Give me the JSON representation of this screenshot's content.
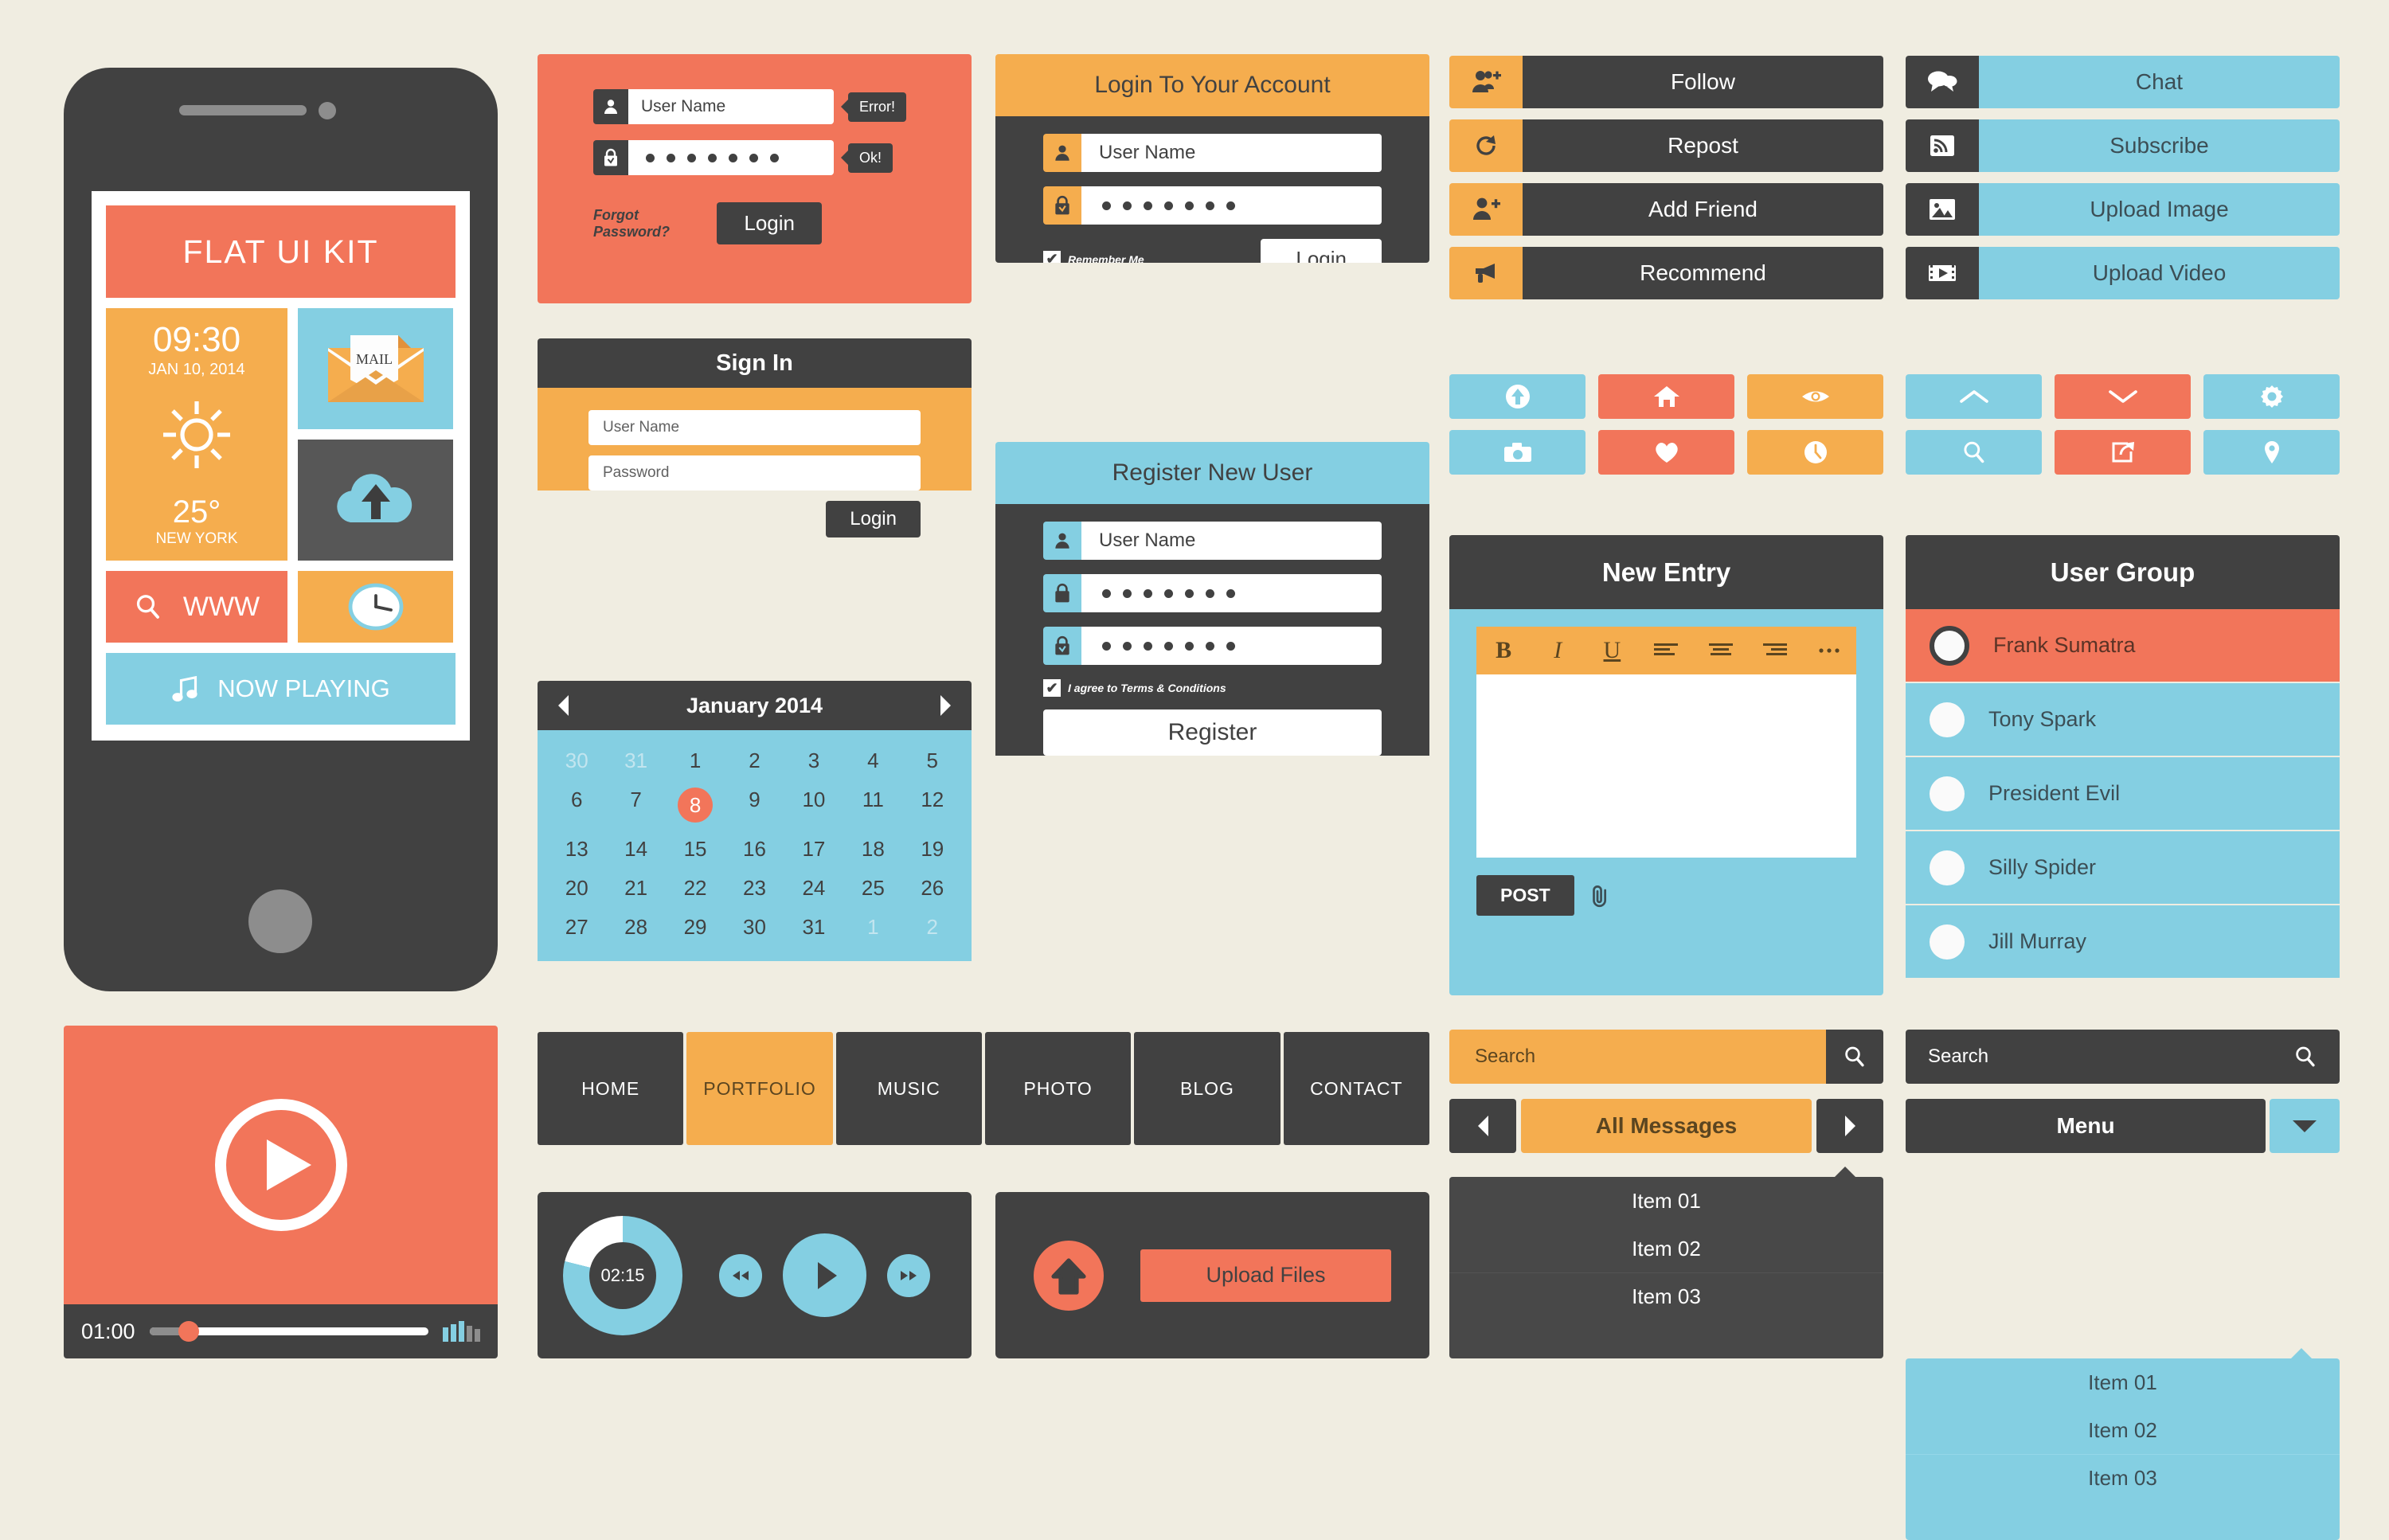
{
  "colors": {
    "background": "#f0ede1",
    "dark": "#414141",
    "orange": "#f2755a",
    "yellow": "#f5ad4e",
    "blue": "#84cfe2",
    "white": "#ffffff"
  },
  "phone": {
    "title": "FLAT UI KIT",
    "weather": {
      "time": "09:30",
      "date": "JAN 10, 2014",
      "temperature": "25°",
      "city": "NEW YORK",
      "icon": "sun-icon"
    },
    "mail_tile": {
      "label": "MAIL",
      "icon": "envelope-icon"
    },
    "cloud_tile": {
      "icon": "cloud-upload-icon"
    },
    "www_tile": {
      "label": "WWW",
      "icon": "search-icon"
    },
    "clock_tile": {
      "icon": "clock-icon"
    },
    "now_playing_tile": {
      "label": "NOW PLAYING",
      "icon": "music-note-icon"
    }
  },
  "video_player": {
    "play_icon": "play-circle-icon",
    "current_time": "01:00",
    "progress_percent": 14,
    "volume_icon": "volume-bars-icon"
  },
  "error_login_form": {
    "username_value": "User Name",
    "username_icon": "user-icon",
    "username_status": "Error!",
    "password_value": "•••••••",
    "password_icon": "lock-check-icon",
    "password_status": "Ok!",
    "forgot_label": "Forgot Password?",
    "login_label": "Login"
  },
  "signin_form": {
    "title": "Sign In",
    "username_placeholder": "User Name",
    "password_placeholder": "Password",
    "login_label": "Login"
  },
  "calendar": {
    "title": "January 2014",
    "prev_icon": "triangle-left-icon",
    "next_icon": "triangle-right-icon",
    "selected_day": 8,
    "weeks": [
      [
        {
          "d": "30",
          "mut": true
        },
        {
          "d": "31",
          "mut": true
        },
        {
          "d": "1"
        },
        {
          "d": "2"
        },
        {
          "d": "3"
        },
        {
          "d": "4"
        },
        {
          "d": "5"
        }
      ],
      [
        {
          "d": "6"
        },
        {
          "d": "7"
        },
        {
          "d": "8",
          "sel": true
        },
        {
          "d": "9"
        },
        {
          "d": "10"
        },
        {
          "d": "11"
        },
        {
          "d": "12"
        }
      ],
      [
        {
          "d": "13"
        },
        {
          "d": "14"
        },
        {
          "d": "15"
        },
        {
          "d": "16"
        },
        {
          "d": "17"
        },
        {
          "d": "18"
        },
        {
          "d": "19"
        }
      ],
      [
        {
          "d": "20"
        },
        {
          "d": "21"
        },
        {
          "d": "22"
        },
        {
          "d": "23"
        },
        {
          "d": "24"
        },
        {
          "d": "25"
        },
        {
          "d": "26"
        }
      ],
      [
        {
          "d": "27"
        },
        {
          "d": "28"
        },
        {
          "d": "29"
        },
        {
          "d": "30"
        },
        {
          "d": "31"
        },
        {
          "d": "1",
          "mut": true
        },
        {
          "d": "2",
          "mut": true
        }
      ]
    ]
  },
  "navbar": {
    "items": [
      {
        "label": "HOME",
        "active": false
      },
      {
        "label": "PORTFOLIO",
        "active": true
      },
      {
        "label": "MUSIC",
        "active": false
      },
      {
        "label": "PHOTO",
        "active": false
      },
      {
        "label": "BLOG",
        "active": false
      },
      {
        "label": "CONTACT",
        "active": false
      }
    ]
  },
  "music_player": {
    "elapsed": "02:15",
    "progress_percent": 79,
    "rewind_icon": "rewind-icon",
    "play_icon": "play-icon",
    "forward_icon": "fast-forward-icon"
  },
  "login_account_form": {
    "title": "Login To Your Account",
    "username_value": "User Name",
    "username_icon": "user-icon",
    "password_value": "•••••••",
    "password_icon": "lock-check-icon",
    "remember_label": "Remember Me",
    "remember_checked": true,
    "login_label": "Login"
  },
  "register_form": {
    "title": "Register New User",
    "username_value": "User Name",
    "username_icon": "user-icon",
    "password_value": "•••••••",
    "password_icon": "lock-icon",
    "confirm_value": "•••••••",
    "confirm_icon": "lock-check-icon",
    "terms_label": "I agree to Terms & Conditions",
    "terms_checked": true,
    "register_label": "Register"
  },
  "upload_panel": {
    "icon": "upload-arrow-icon",
    "button_label": "Upload Files"
  },
  "social_buttons_yellow": [
    {
      "label": "Follow",
      "icon": "add-users-icon"
    },
    {
      "label": "Repost",
      "icon": "repost-icon"
    },
    {
      "label": "Add Friend",
      "icon": "add-user-icon"
    },
    {
      "label": "Recommend",
      "icon": "megaphone-icon"
    }
  ],
  "social_buttons_blue": [
    {
      "label": "Chat",
      "icon": "chat-bubbles-icon"
    },
    {
      "label": "Subscribe",
      "icon": "rss-icon"
    },
    {
      "label": "Upload Image",
      "icon": "image-icon"
    },
    {
      "label": "Upload Video",
      "icon": "video-icon"
    }
  ],
  "icon_grid_left": [
    {
      "icon": "arrow-up-circle-icon",
      "color": "#84cfe2"
    },
    {
      "icon": "home-icon",
      "color": "#f2755a"
    },
    {
      "icon": "eye-icon",
      "color": "#f5ad4e"
    },
    {
      "icon": "camera-icon",
      "color": "#84cfe2"
    },
    {
      "icon": "heart-icon",
      "color": "#f2755a"
    },
    {
      "icon": "clock-icon",
      "color": "#f5ad4e"
    }
  ],
  "icon_grid_right": [
    {
      "icon": "chevron-up-icon",
      "color": "#84cfe2"
    },
    {
      "icon": "chevron-down-icon",
      "color": "#f2755a"
    },
    {
      "icon": "gear-icon",
      "color": "#84cfe2"
    },
    {
      "icon": "search-icon",
      "color": "#84cfe2"
    },
    {
      "icon": "share-icon",
      "color": "#f2755a"
    },
    {
      "icon": "location-pin-icon",
      "color": "#84cfe2"
    }
  ],
  "new_entry": {
    "title": "New Entry",
    "toolbar": [
      "B",
      "I",
      "U",
      "align-left-icon",
      "align-center-icon",
      "align-right-icon",
      "more-icon"
    ],
    "post_label": "POST",
    "attach_icon": "paperclip-icon"
  },
  "user_group": {
    "title": "User Group",
    "members": [
      {
        "name": "Frank Sumatra",
        "active": true
      },
      {
        "name": "Tony Spark",
        "active": false
      },
      {
        "name": "President Evil",
        "active": false
      },
      {
        "name": "Silly Spider",
        "active": false
      },
      {
        "name": "Jill Murray",
        "active": false
      }
    ]
  },
  "search_yellow": {
    "placeholder": "Search",
    "button_icon": "search-icon"
  },
  "pager_yellow": {
    "prev_icon": "triangle-left-icon",
    "label": "All Messages",
    "next_icon": "triangle-right-icon"
  },
  "dropdown_dark": {
    "items": [
      "Item 01",
      "Item 02",
      "Item 03"
    ]
  },
  "search_dark": {
    "placeholder": "Search",
    "button_icon": "search-icon"
  },
  "menu_dark": {
    "label": "Menu",
    "caret_icon": "triangle-down-icon"
  },
  "dropdown_blue": {
    "items": [
      "Item 01",
      "Item 02",
      "Item 03"
    ]
  }
}
